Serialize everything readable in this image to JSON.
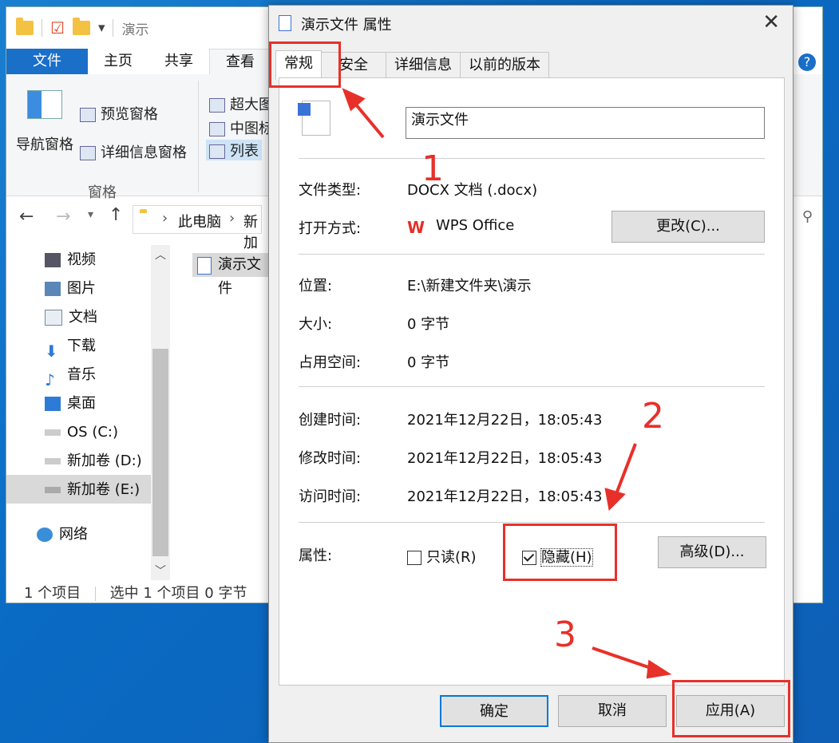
{
  "explorer": {
    "breadcrumb_title": "演示",
    "ribbon_tabs": [
      "文件",
      "主页",
      "共享",
      "查看"
    ],
    "nav_pane": "导航窗格",
    "preview_pane": "预览窗格",
    "details_pane": "详细信息窗格",
    "group_label": "窗格",
    "layout_items": [
      "超大图",
      "中图标",
      "列表"
    ],
    "address": {
      "root": "此电脑",
      "folder": "新加"
    },
    "nav_items": [
      "视频",
      "图片",
      "文档",
      "下载",
      "音乐",
      "桌面",
      "OS (C:)",
      "新加卷 (D:)",
      "新加卷 (E:)",
      "网络"
    ],
    "file_item": "演示文件",
    "status_count": "1 个项目",
    "status_selected": "选中 1 个项目  0 字节"
  },
  "dialog": {
    "title": "演示文件 属性",
    "tabs": [
      "常规",
      "安全",
      "详细信息",
      "以前的版本"
    ],
    "filename": "演示文件",
    "rows": {
      "type_label": "文件类型:",
      "type_value": "DOCX 文档 (.docx)",
      "open_label": "打开方式:",
      "open_value": "WPS Office",
      "change_btn": "更改(C)...",
      "loc_label": "位置:",
      "loc_value": "E:\\新建文件夹\\演示",
      "size_label": "大小:",
      "size_value": "0 字节",
      "disk_label": "占用空间:",
      "disk_value": "0 字节",
      "created_label": "创建时间:",
      "created_value": "2021年12月22日，18:05:43",
      "modified_label": "修改时间:",
      "modified_value": "2021年12月22日，18:05:43",
      "accessed_label": "访问时间:",
      "accessed_value": "2021年12月22日，18:05:43",
      "attr_label": "属性:",
      "readonly": "只读(R)",
      "hidden": "隐藏(H)",
      "advanced_btn": "高级(D)..."
    },
    "buttons": {
      "ok": "确定",
      "cancel": "取消",
      "apply": "应用(A)"
    }
  },
  "annotations": {
    "n1": "1",
    "n2": "2",
    "n3": "3",
    "accent": "#e8302a"
  }
}
